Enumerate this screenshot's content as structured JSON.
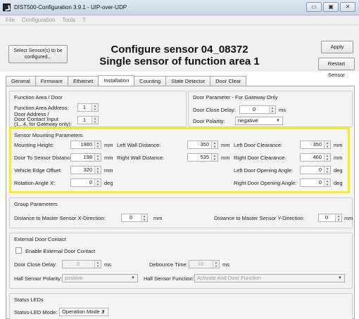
{
  "window": {
    "title": "DIST500-Configuration 3.9.1  -  UIP-over-UDP",
    "buttons": {
      "minimize": "▭",
      "maximize": "▣",
      "close": "✕"
    }
  },
  "menu": [
    "File",
    "Configuration",
    "Tools",
    "?"
  ],
  "header": {
    "select_sensor": "Select Sensor(s) to be configured...",
    "title_line1": "Configure sensor 04_08372",
    "title_line2": "Single sensor of function area 1",
    "apply": "Apply",
    "restart": "Restart Sensor"
  },
  "tabs": [
    "General",
    "Firmware",
    "Ethernet",
    "Installation",
    "Counting",
    "State Detector",
    "Door Clear"
  ],
  "active_tab": "Installation",
  "function_area": {
    "title": "Function Area / Door",
    "area_address_label": "Function Area Address:",
    "area_address_value": "1",
    "door_address_label_1": "Door Address /",
    "door_address_label_2": "Door Contact Input",
    "door_address_label_3": "(1...4, for Gateway only):",
    "door_address_value": "1"
  },
  "door_parameter": {
    "title": "Door Parameter - For Gateway Only",
    "close_delay_label": "Door Close Delay:",
    "close_delay_value": "0",
    "close_delay_unit": "ms",
    "polarity_label": "Door Polarity:",
    "polarity_value": "negative"
  },
  "mounting": {
    "title": "Sensor Mounting Parameters",
    "mounting_height_label": "Mounting Height:",
    "mounting_height_value": "1980",
    "door_to_sensor_label": "Door To Sensor Distance:",
    "door_to_sensor_value": "198",
    "vehicle_edge_label": "Vehicle Edge Offset:",
    "vehicle_edge_value": "320",
    "rotation_label": "Rotation Angle X:",
    "rotation_value": "0",
    "left_wall_label": "Left Wall Distance:",
    "left_wall_value": "350",
    "right_wall_label": "Right Wall Distance:",
    "right_wall_value": "535",
    "left_door_clear_label": "Left Door Clearance:",
    "left_door_clear_value": "350",
    "right_door_clear_label": "Right Door Clearance:",
    "right_door_clear_value": "460",
    "left_door_angle_label": "Left Door Opening Angle:",
    "left_door_angle_value": "0",
    "right_door_angle_label": "Right Door Opening Angle:",
    "right_door_angle_value": "0",
    "unit_mm": "mm",
    "unit_deg": "deg"
  },
  "group_params": {
    "title": "Group Parameters",
    "x_label": "Distance to Master Sensor X-Direction:",
    "x_value": "0",
    "y_label": "Distance to Master Sensor Y-Direction:",
    "y_value": "0",
    "unit": "mm"
  },
  "external_door": {
    "title": "External Door Contact",
    "enable_label": "Enable External Door Contact",
    "close_delay_label": "Door Close Delay:",
    "close_delay_value": "0",
    "close_delay_unit": "ms",
    "debounce_label": "Debounce Time:",
    "debounce_value": "10",
    "debounce_unit": "ms",
    "hall_polarity_label": "Hall Sensor Polarity:",
    "hall_polarity_value": "positive",
    "hall_function_label": "Hall Sensor Function:",
    "hall_function_value": "Activate And Door Function"
  },
  "status_leds": {
    "title": "Status LEDs",
    "mode_label": "Status-LED Mode:",
    "mode_value": "Operation Mode 1"
  },
  "colors": {
    "highlight": "#f5ee1b"
  }
}
